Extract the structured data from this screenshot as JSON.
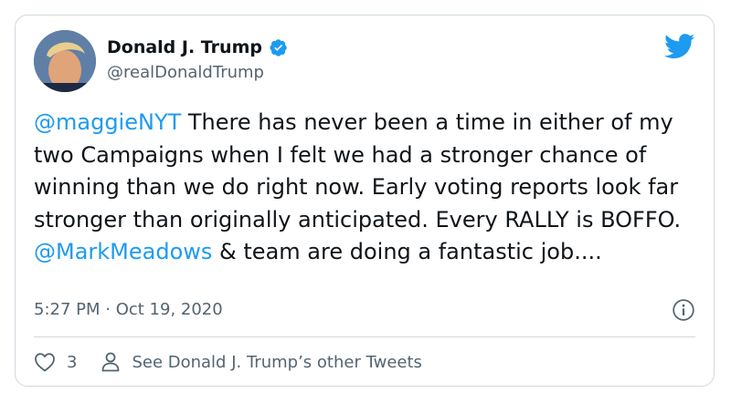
{
  "tweet": {
    "author_name": "Donald J. Trump",
    "author_handle": "@realDonaldTrump",
    "text_segments": [
      {
        "type": "mention",
        "text": "@maggieNYT"
      },
      {
        "type": "text",
        "text": "  There has never been a time in either of my two Campaigns when I felt we had a stronger chance of winning than we do right now. Early voting reports look far stronger than originally anticipated. Every RALLY is BOFFO. "
      },
      {
        "type": "mention",
        "text": "@MarkMeadows"
      },
      {
        "type": "text",
        "text": " & team are doing a fantastic job...."
      }
    ],
    "timestamp": "5:27 PM · Oct 19, 2020",
    "like_count": "3",
    "profile_link_label": "See Donald J. Trump’s other Tweets"
  },
  "icons": {
    "verified": "verified-badge-icon",
    "brand": "twitter-bird-icon",
    "info": "info-icon",
    "like": "heart-icon",
    "profile": "person-icon"
  },
  "colors": {
    "accent": "#1d9bf0",
    "text": "#0f1419",
    "muted": "#536471",
    "border": "#cfd9de"
  }
}
